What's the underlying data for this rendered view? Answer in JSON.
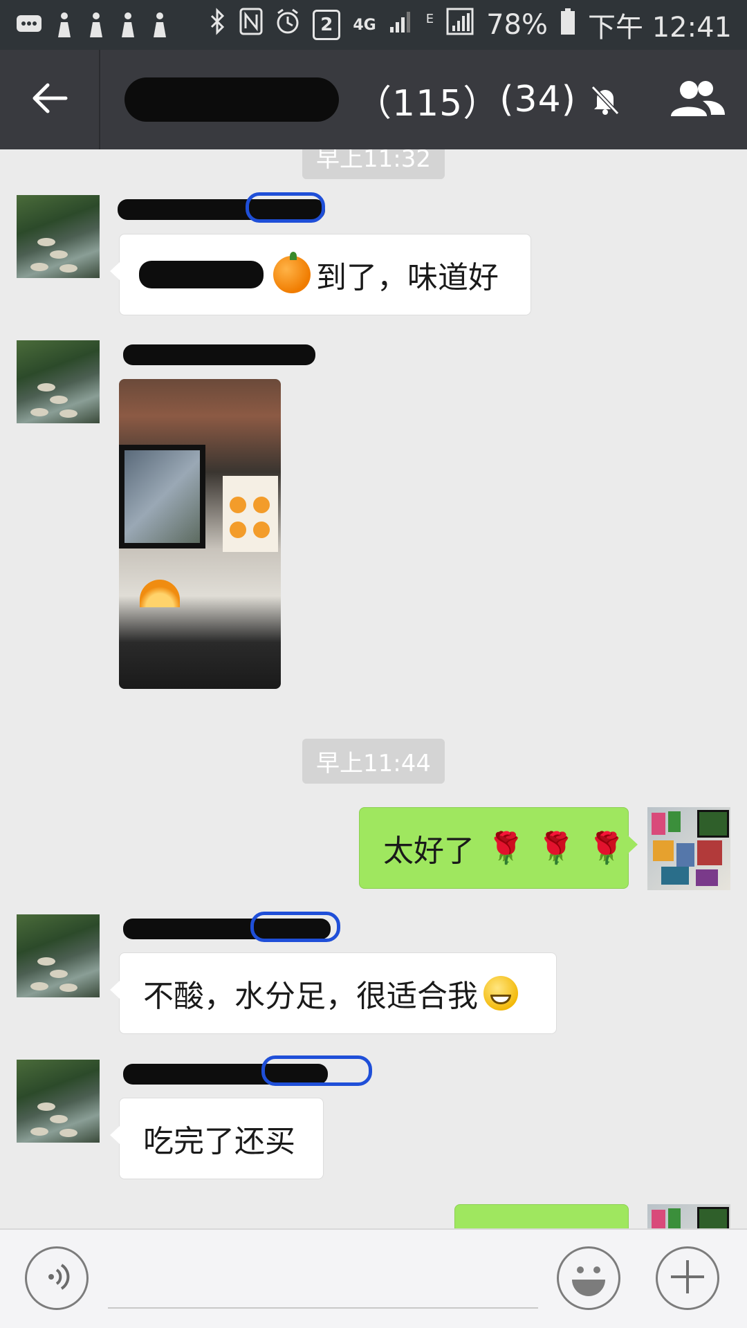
{
  "status_bar": {
    "sim_badge": "2",
    "network": "4G",
    "edge": "E",
    "battery": "78%",
    "time": "下午 12:41"
  },
  "header": {
    "group_name": "",
    "member_count": "（115）",
    "unread_count": "(34)"
  },
  "messages": [
    {
      "type": "time",
      "text": "早上11:32"
    },
    {
      "type": "text",
      "side": "left",
      "text": "到了，味道好"
    },
    {
      "type": "image",
      "side": "left"
    },
    {
      "type": "time",
      "text": "早上11:44"
    },
    {
      "type": "text",
      "side": "right",
      "text": "太好了"
    },
    {
      "type": "text",
      "side": "left",
      "text": "不酸，水分足，很适合我"
    },
    {
      "type": "text",
      "side": "left",
      "text": "吃完了还买"
    }
  ],
  "icons": {
    "back": "back-arrow-icon",
    "mute": "bell-off-icon",
    "members": "group-members-icon",
    "voice": "voice-icon",
    "emoji": "emoji-icon",
    "plus": "plus-icon"
  },
  "colors": {
    "title_bar": "#393a3f",
    "status_bar": "#2f3438",
    "chat_bg": "#ebebeb",
    "sent_bubble": "#9fe75f",
    "received_bubble": "#ffffff"
  }
}
